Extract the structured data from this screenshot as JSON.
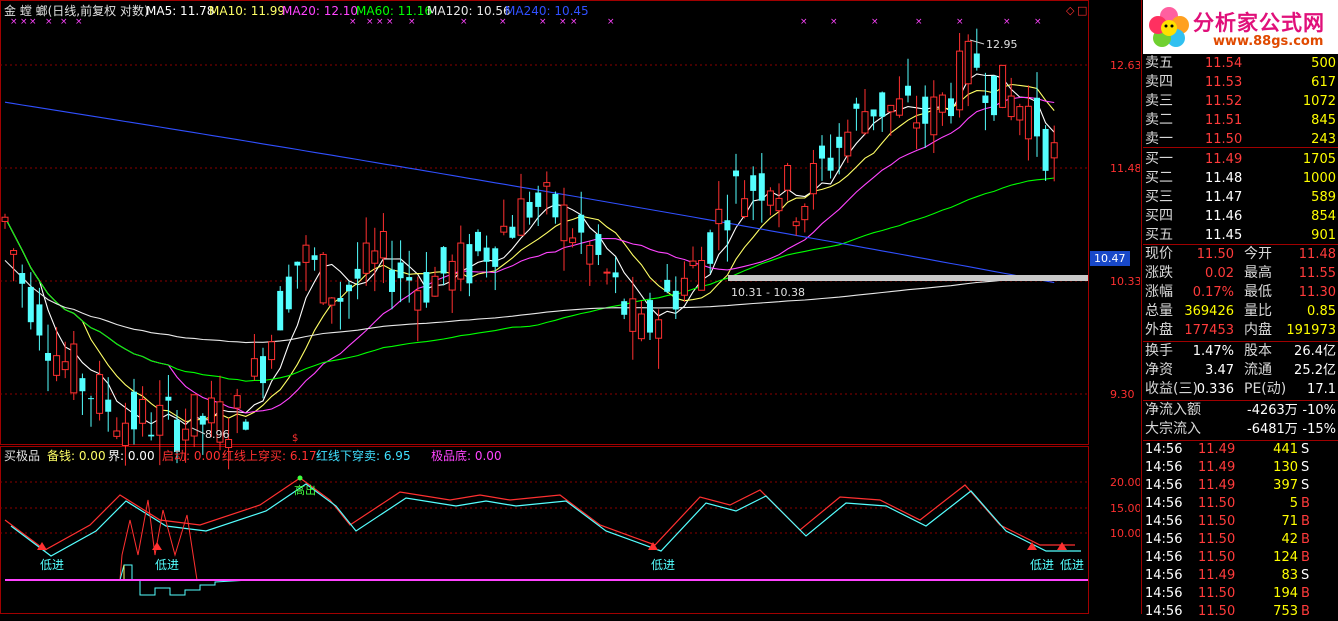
{
  "header": {
    "stock": "金 螳 螂(日线,前复权 对数)",
    "ma": [
      {
        "label": "MA5: 11.78",
        "color": "#ffffff"
      },
      {
        "label": "MA10: 11.99",
        "color": "#ffff66"
      },
      {
        "label": "MA20: 12.10",
        "color": "#ff44ff"
      },
      {
        "label": "MA60: 11.16",
        "color": "#00ff00"
      },
      {
        "label": "MA120: 10.56",
        "color": "#e8e8e8"
      },
      {
        "label": "MA240: 10.45",
        "color": "#3050ff"
      }
    ]
  },
  "price_axis": {
    "labels": [
      "12.63",
      "11.48",
      "10.33",
      "9.30"
    ],
    "current": "10.47"
  },
  "annotations": {
    "high": "12.95",
    "low": "8.96",
    "range": "10.31 - 10.38"
  },
  "indicator": {
    "title": "买极品",
    "params": [
      {
        "label": "备钱: 0.00",
        "color": "#ffff66"
      },
      {
        "label": "界: 0.00",
        "color": "#ffffff"
      },
      {
        "label": "启动: 0.00",
        "color": "#ff3030"
      },
      {
        "label": "红线上穿买: 6.17",
        "color": "#ff3030"
      },
      {
        "label": "红线下穿卖: 6.95",
        "color": "#40e0ff"
      },
      {
        "label": "极品底: 0.00",
        "color": "#ff44ff"
      }
    ],
    "axis": [
      "20.00",
      "15.00",
      "10.00"
    ],
    "signals": {
      "high": "高出",
      "low": "低进"
    }
  },
  "chart_data": {
    "type": "candlestick",
    "title": "金 螳 螂(日线,前复权 对数)",
    "price_ticks": [
      12.63,
      11.48,
      10.33,
      9.3
    ],
    "ylim": [
      8.8,
      13.1
    ],
    "high": 12.95,
    "low": 8.96,
    "last": 10.47
  },
  "logo": {
    "name": "分析家公式网",
    "url": "www.88gs.com"
  },
  "orderbook": {
    "asks": [
      {
        "label": "卖五",
        "price": "11.54",
        "vol": "500"
      },
      {
        "label": "卖四",
        "price": "11.53",
        "vol": "617"
      },
      {
        "label": "卖三",
        "price": "11.52",
        "vol": "1072"
      },
      {
        "label": "卖二",
        "price": "11.51",
        "vol": "845"
      },
      {
        "label": "卖一",
        "price": "11.50",
        "vol": "243"
      }
    ],
    "bids": [
      {
        "label": "买一",
        "price": "11.49",
        "vol": "1705"
      },
      {
        "label": "买二",
        "price": "11.48",
        "vol": "1000"
      },
      {
        "label": "买三",
        "price": "11.47",
        "vol": "589"
      },
      {
        "label": "买四",
        "price": "11.46",
        "vol": "854"
      },
      {
        "label": "买五",
        "price": "11.45",
        "vol": "901"
      }
    ]
  },
  "quote": [
    {
      "l1": "现价",
      "v1": "11.50",
      "c1": "red",
      "l2": "今开",
      "v2": "11.48",
      "c2": "red"
    },
    {
      "l1": "涨跌",
      "v1": "0.02",
      "c1": "red",
      "l2": "最高",
      "v2": "11.55",
      "c2": "red"
    },
    {
      "l1": "涨幅",
      "v1": "0.17%",
      "c1": "red",
      "l2": "最低",
      "v2": "11.30",
      "c2": "red"
    },
    {
      "l1": "总量",
      "v1": "369426",
      "c1": "yel",
      "l2": "量比",
      "v2": "0.85",
      "c2": "yel"
    },
    {
      "l1": "外盘",
      "v1": "177453",
      "c1": "red",
      "l2": "内盘",
      "v2": "191973",
      "c2": "yel"
    }
  ],
  "fund": [
    {
      "l1": "换手",
      "v1": "1.47%",
      "l2": "股本",
      "v2": "26.4亿"
    },
    {
      "l1": "净资",
      "v1": "3.47",
      "l2": "流通",
      "v2": "25.2亿"
    },
    {
      "l1": "收益(三)",
      "v1": "0.336",
      "l2": "PE(动)",
      "v2": "17.1"
    }
  ],
  "flow": [
    {
      "l": "净流入额",
      "v": "-4263万",
      "p": "-10%"
    },
    {
      "l": "大宗流入",
      "v": "-6481万",
      "p": "-15%"
    }
  ],
  "trades": [
    {
      "t": "14:56",
      "p": "11.49",
      "v": "441",
      "s": "S"
    },
    {
      "t": "14:56",
      "p": "11.49",
      "v": "130",
      "s": "S"
    },
    {
      "t": "14:56",
      "p": "11.49",
      "v": "397",
      "s": "S"
    },
    {
      "t": "14:56",
      "p": "11.50",
      "v": "5",
      "s": "B"
    },
    {
      "t": "14:56",
      "p": "11.50",
      "v": "71",
      "s": "B"
    },
    {
      "t": "14:56",
      "p": "11.50",
      "v": "42",
      "s": "B"
    },
    {
      "t": "14:56",
      "p": "11.50",
      "v": "124",
      "s": "B"
    },
    {
      "t": "14:56",
      "p": "11.49",
      "v": "83",
      "s": "S"
    },
    {
      "t": "14:56",
      "p": "11.50",
      "v": "194",
      "s": "B"
    },
    {
      "t": "14:56",
      "p": "11.50",
      "v": "753",
      "s": "B"
    }
  ]
}
